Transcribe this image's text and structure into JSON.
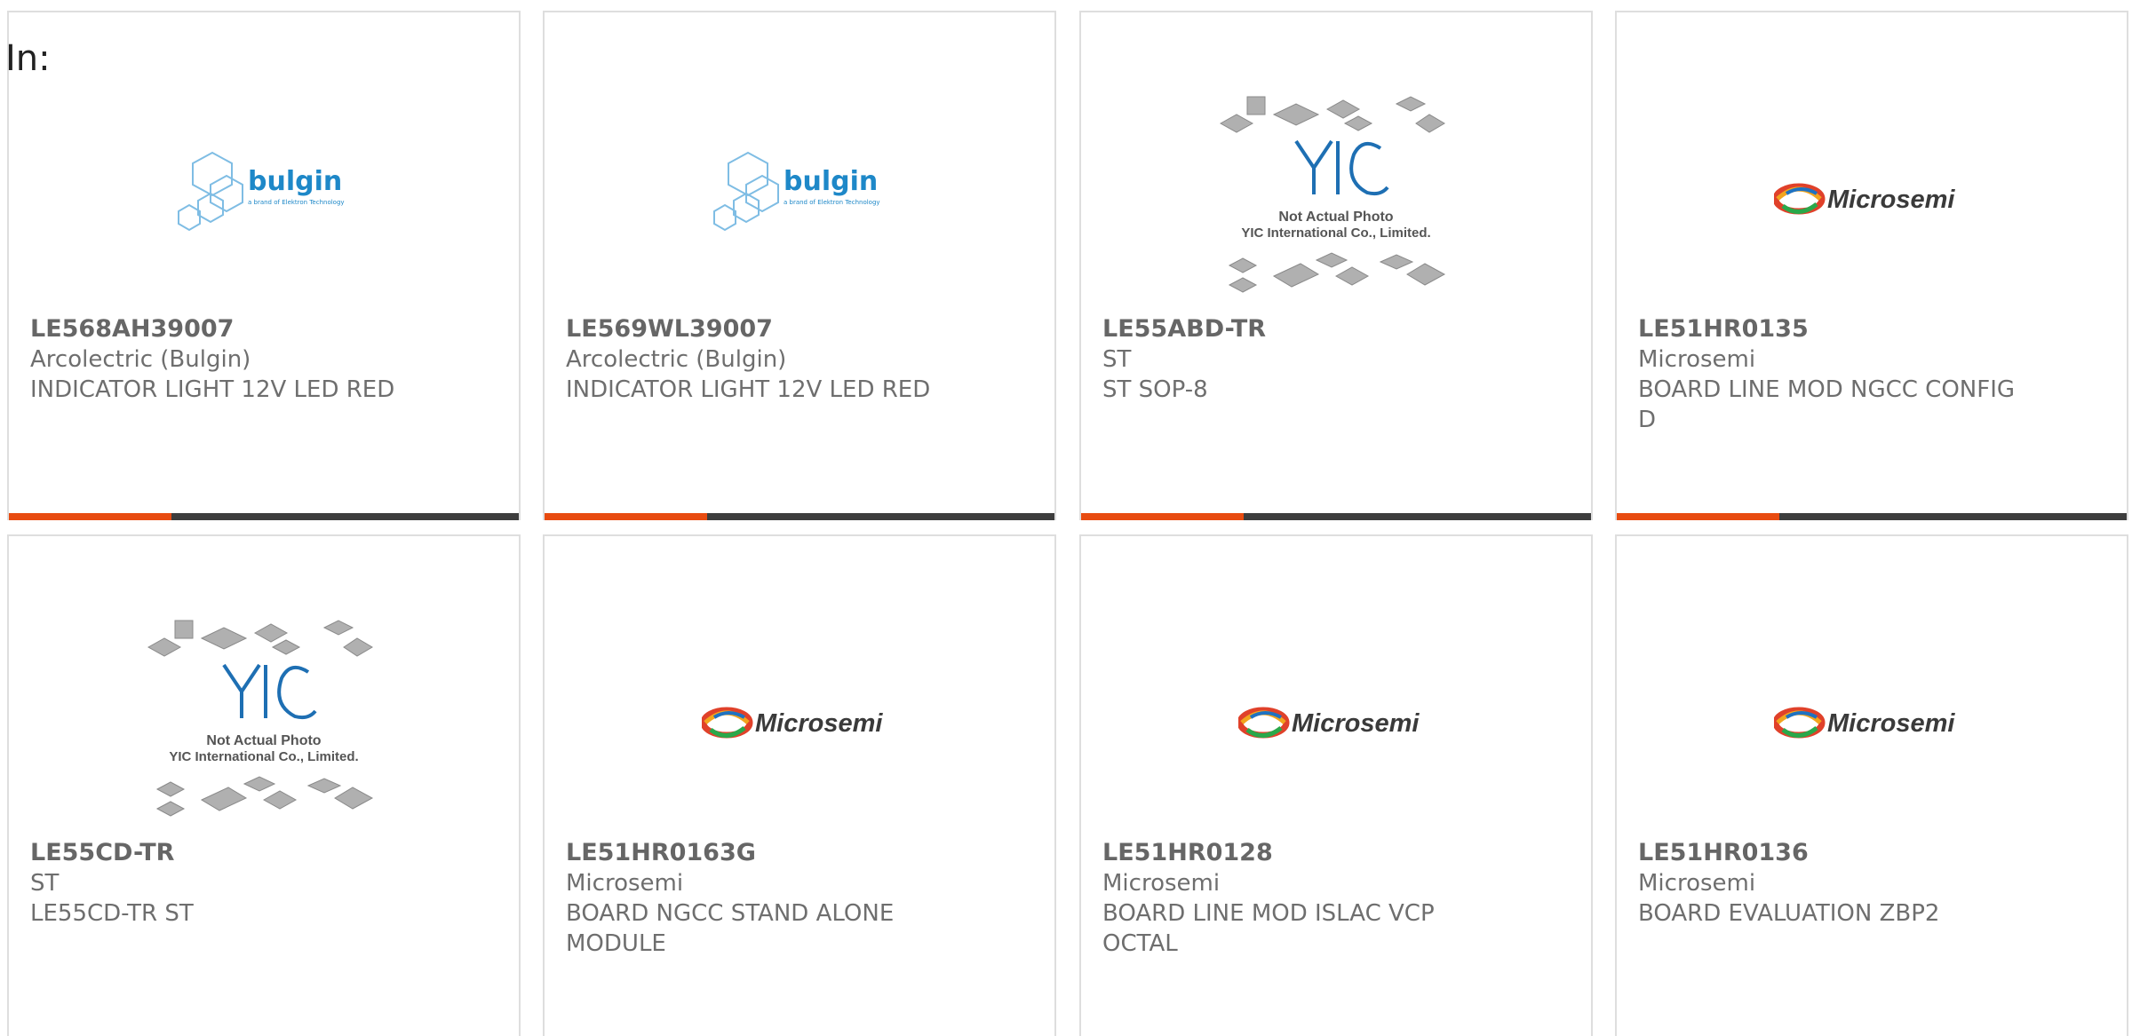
{
  "page": {
    "heading": "In:"
  },
  "colors": {
    "accent_orange": "#e84b10",
    "bar_dark": "#3d3d3d",
    "card_border": "#dedede",
    "bulgin_blue": "#1e88c8"
  },
  "logos": {
    "bulgin": {
      "word": "bulgin",
      "tagline": "a brand of Elektron Technology"
    },
    "microsemi": {
      "word": "Microsemi"
    },
    "yic": {
      "mark": "YIC",
      "caption_line1": "Not Actual Photo",
      "caption_line2": "YIC International Co., Limited."
    }
  },
  "products": [
    {
      "part_number": "LE568AH39007",
      "manufacturer": "Arcolectric (Bulgin)",
      "description": "INDICATOR LIGHT 12V LED RED",
      "logo": "bulgin"
    },
    {
      "part_number": "LE569WL39007",
      "manufacturer": "Arcolectric (Bulgin)",
      "description": "INDICATOR LIGHT 12V LED RED",
      "logo": "bulgin"
    },
    {
      "part_number": "LE55ABD-TR",
      "manufacturer": "ST",
      "description": "ST SOP-8",
      "logo": "yic"
    },
    {
      "part_number": "LE51HR0135",
      "manufacturer": "Microsemi",
      "description": "BOARD LINE MOD NGCC CONFIG\nD",
      "logo": "microsemi"
    },
    {
      "part_number": "LE55CD-TR",
      "manufacturer": "ST",
      "description": "LE55CD-TR ST",
      "logo": "yic"
    },
    {
      "part_number": "LE51HR0163G",
      "manufacturer": "Microsemi",
      "description": "BOARD NGCC STAND ALONE\nMODULE",
      "logo": "microsemi"
    },
    {
      "part_number": "LE51HR0128",
      "manufacturer": "Microsemi",
      "description": "BOARD LINE MOD ISLAC VCP\nOCTAL",
      "logo": "microsemi"
    },
    {
      "part_number": "LE51HR0136",
      "manufacturer": "Microsemi",
      "description": "BOARD EVALUATION ZBP2",
      "logo": "microsemi"
    }
  ]
}
